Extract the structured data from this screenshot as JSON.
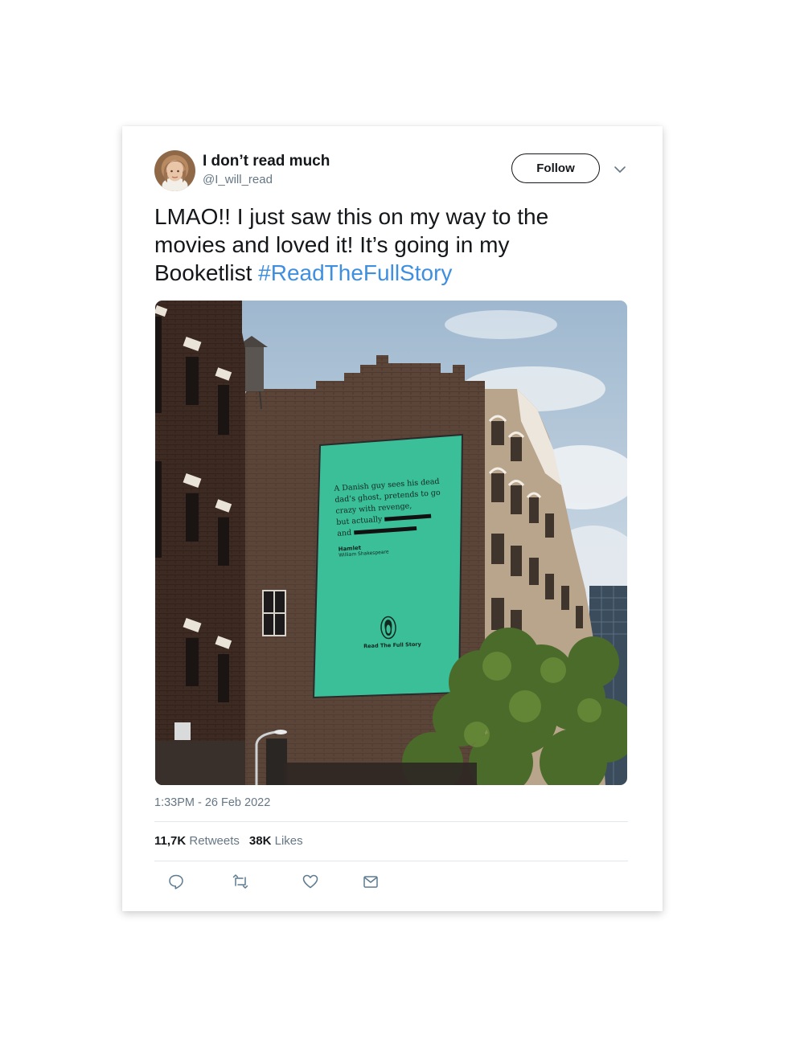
{
  "tweet": {
    "user": {
      "display_name": "I don’t read much",
      "handle": "@I_will_read"
    },
    "follow_label": "Follow",
    "text": "LMAO!! I just saw this on my way to the movies and loved it! It’s going in my Booketlist ",
    "hashtag": "#ReadTheFullStory",
    "timestamp": "1:33PM - 26 Feb 2022",
    "stats": {
      "retweets_count": "11,7K",
      "retweets_label": "Retweets",
      "likes_count": "38K",
      "likes_label": "Likes"
    }
  },
  "billboard": {
    "line1": "A Danish guy sees his dead",
    "line2": "dad’s ghost, pretends to go",
    "line3": "crazy with revenge,",
    "line4": "but actually",
    "line5": "and",
    "book_title": "Hamlet",
    "book_author": "William Shakespeare",
    "tagline": "Read The Full Story"
  },
  "icons": [
    "avatar",
    "chevron-down-icon",
    "reply-icon",
    "retweet-icon",
    "like-icon",
    "dm-icon",
    "penguin-logo"
  ],
  "colors": {
    "hashtag": "#3f8fe0",
    "billboard": "#3bbf98",
    "text": "#14171a",
    "secondary": "#657786"
  }
}
